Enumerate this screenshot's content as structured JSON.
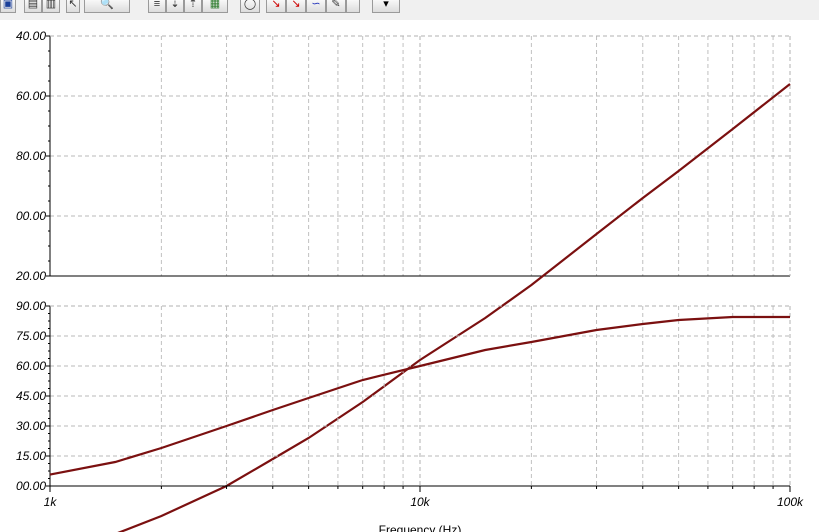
{
  "toolbar": {
    "buttons": [
      {
        "name": "app-icon",
        "glyph": "▣",
        "color": "#1a3f9a"
      },
      {
        "name": "copy-icon",
        "glyph": "▤",
        "color": "#333333"
      },
      {
        "name": "paste-icon",
        "glyph": "▥",
        "color": "#333333"
      },
      {
        "name": "pointer-icon",
        "glyph": "↖",
        "color": "#333333"
      },
      {
        "name": "zoom-100-icon",
        "glyph": "🔍",
        "color": "#333333"
      },
      {
        "name": "align-icon",
        "glyph": "≡",
        "color": "#333333"
      },
      {
        "name": "sort-asc-icon",
        "glyph": "⇣",
        "color": "#333333"
      },
      {
        "name": "sort-desc-icon",
        "glyph": "⇡",
        "color": "#333333"
      },
      {
        "name": "table-icon",
        "glyph": "▦",
        "color": "#2a7a2a"
      },
      {
        "name": "circle-icon",
        "glyph": "◯",
        "color": "#333333"
      },
      {
        "name": "red-arrow-icon",
        "glyph": "↘",
        "color": "#cc0000"
      },
      {
        "name": "red-cursor-icon",
        "glyph": "↘",
        "color": "#cc0000"
      },
      {
        "name": "curve-icon",
        "glyph": "∽",
        "color": "#2233bb"
      },
      {
        "name": "pen-icon",
        "glyph": "✎",
        "color": "#333333"
      },
      {
        "name": "blank-icon",
        "glyph": "",
        "color": "#333333"
      },
      {
        "name": "dropdown-icon",
        "glyph": "▾",
        "color": "#000000"
      }
    ]
  },
  "chart_data": [
    {
      "type": "line",
      "xscale": "log",
      "xlim": [
        1000,
        100000
      ],
      "ylim": [
        -220,
        -40
      ],
      "ytick_labels": [
        "40.00",
        "60.00",
        "80.00",
        "00.00",
        "20.00"
      ],
      "ytick_values": [
        -40,
        -60,
        -80,
        -100,
        -120
      ],
      "series": [
        {
          "color": "#7b1010",
          "x": [
            1000,
            1500,
            2000,
            3000,
            4000,
            5000,
            7000,
            10000,
            15000,
            20000,
            30000,
            40000,
            50000,
            70000,
            100000
          ],
          "y": [
            -212,
            -206,
            -200,
            -190,
            -181,
            -174,
            -162,
            -148,
            -134,
            -123,
            -106,
            -94,
            -85,
            -71,
            -56
          ]
        }
      ]
    },
    {
      "type": "line",
      "xscale": "log",
      "xlim": [
        1000,
        100000
      ],
      "ylim": [
        0,
        90
      ],
      "ytick_labels": [
        "90.00",
        "75.00",
        "60.00",
        "45.00",
        "30.00",
        "15.00",
        "00.00"
      ],
      "ytick_values": [
        90,
        75,
        60,
        45,
        30,
        15,
        0
      ],
      "series": [
        {
          "color": "#7b1010",
          "x": [
            1000,
            1500,
            2000,
            3000,
            4000,
            5000,
            7000,
            10000,
            15000,
            20000,
            30000,
            40000,
            50000,
            70000,
            100000
          ],
          "y": [
            5.7,
            12,
            19,
            30,
            38,
            44,
            53,
            60,
            68,
            72,
            78,
            81,
            83,
            84.5,
            84.5
          ]
        }
      ],
      "x_tick_labels": [
        "1k",
        "10k",
        "100k"
      ],
      "x_tick_values": [
        1000,
        10000,
        100000
      ],
      "xlabel": "Frequency (Hz)"
    }
  ]
}
